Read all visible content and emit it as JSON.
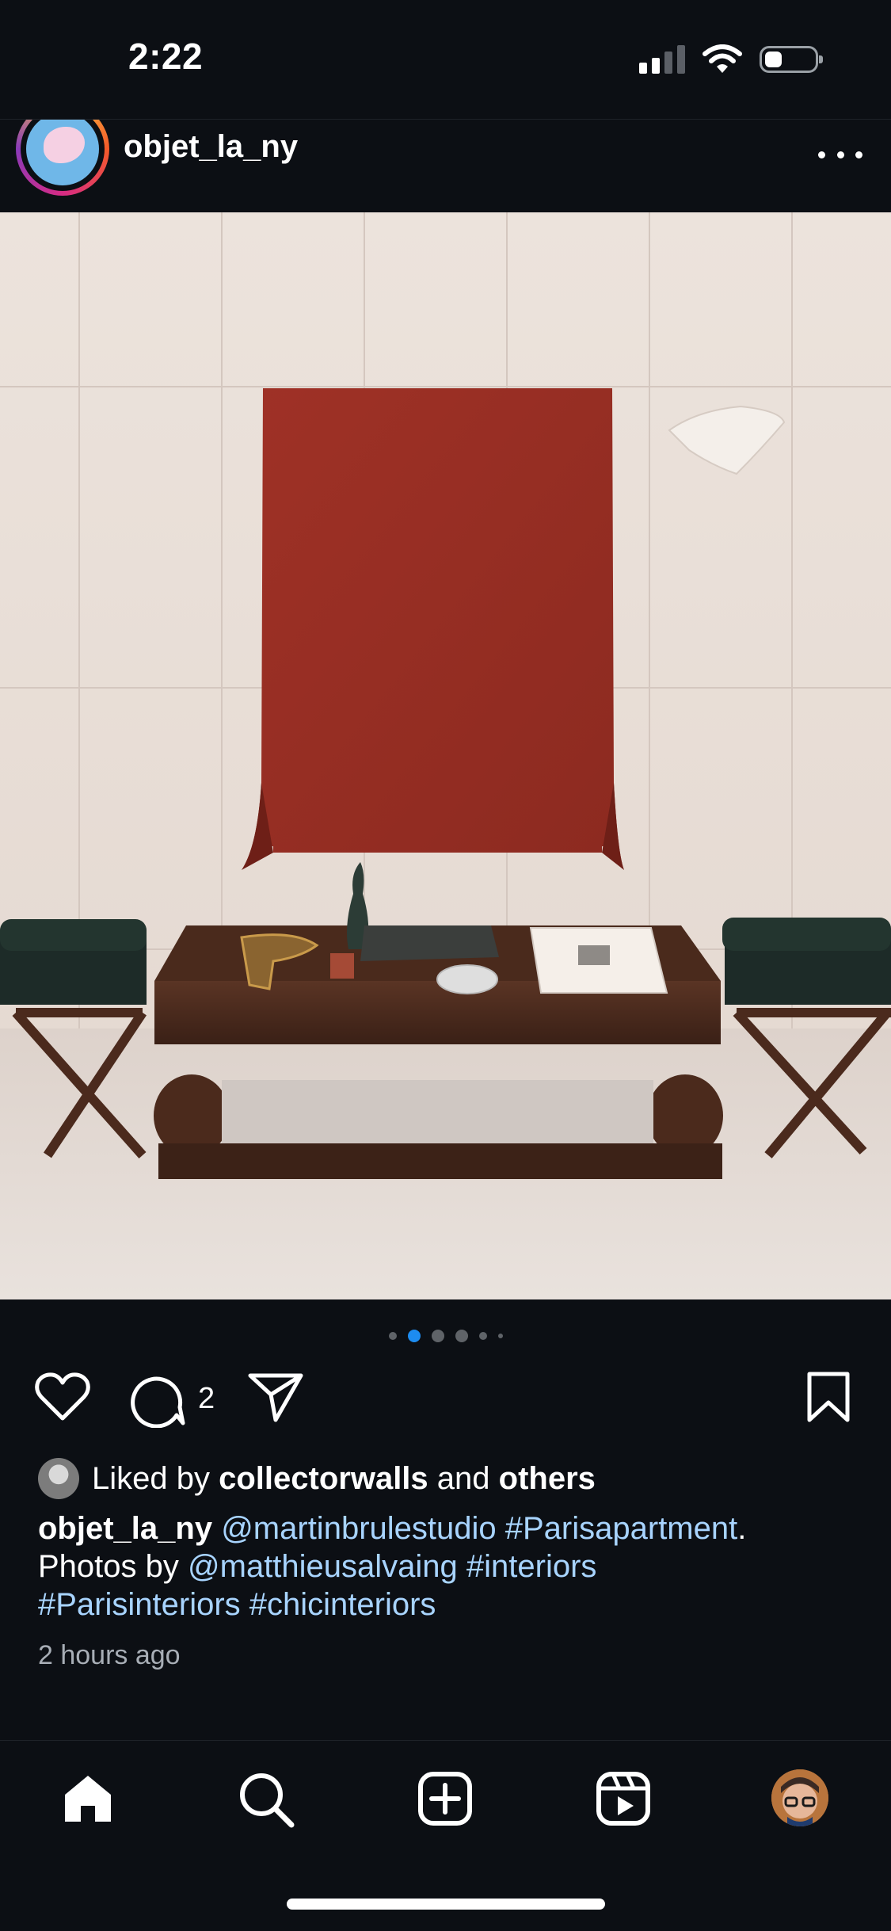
{
  "status_bar": {
    "time": "2:22",
    "battery_level": 0.35
  },
  "post": {
    "username": "objet_la_ny",
    "carousel": {
      "count": 6,
      "active_index": 1
    },
    "comment_count": "2",
    "liked_by": {
      "prefix": "Liked by ",
      "user": "collectorwalls",
      "middle": " and ",
      "others": "others"
    },
    "caption": {
      "author": "objet_la_ny",
      "mention1": "@martinbrulestudio",
      "tag1": "#Parisapartment",
      "period": ".",
      "photos_by": "Photos by ",
      "mention2": "@matthieusalvaing",
      "tag2": "#interiors",
      "tag3": "#Parisinteriors",
      "tag4": "#chicinteriors"
    },
    "time_ago": "2 hours ago"
  },
  "icons": {
    "header": [
      "avatar",
      "more-icon"
    ],
    "actions": [
      "heart-icon",
      "comment-icon",
      "share-icon",
      "bookmark-icon"
    ],
    "nav": [
      "home-icon",
      "search-icon",
      "create-icon",
      "reels-icon",
      "profile-avatar"
    ]
  },
  "colors": {
    "background": "#0c0f14",
    "link": "#a8d4ff",
    "active_dot": "#1d8cf0",
    "secondary_text": "#a8aeb6"
  }
}
